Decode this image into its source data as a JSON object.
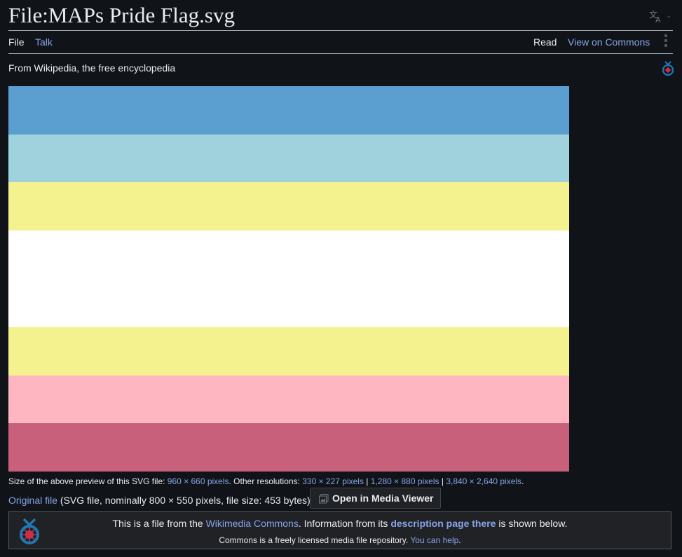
{
  "page": {
    "title": "File:MAPs Pride Flag.svg",
    "tagline": "From Wikipedia, the free encyclopedia",
    "language_icon": "translate-icon"
  },
  "tabs": {
    "file": "File",
    "talk": "Talk",
    "read": "Read",
    "view_on_commons": "View on Commons"
  },
  "flag": {
    "stripes": [
      {
        "color": "#5a9fd0"
      },
      {
        "color": "#a0d2de"
      },
      {
        "color": "#f4f28f"
      },
      {
        "color": "#ffffff"
      },
      {
        "color": "#f4f28f"
      },
      {
        "color": "#feb6c1"
      },
      {
        "color": "#c9607b"
      }
    ]
  },
  "size_info": {
    "prefix": "Size of the above preview of this SVG file: ",
    "preview_size": "960 × 660 pixels",
    "other_label": ". Other resolutions: ",
    "res1": "330 × 227 pixels",
    "separator": " | ",
    "res2": "1,280 × 880 pixels",
    "res3": "3,840 × 2,640 pixels",
    "suffix": "."
  },
  "original": {
    "link": "Original file",
    "details": " (SVG file, nominally 800 × 550 pixels, file size: 453 bytes)"
  },
  "media_viewer": {
    "label": "Open in Media Viewer"
  },
  "commons_notice": {
    "part1": "This is a file from the ",
    "link1": "Wikimedia Commons",
    "part2": ". Information from its ",
    "link2": "description page there",
    "part3": " is shown below.",
    "line2": "Commons is a freely licensed media file repository. ",
    "help_link": "You can help",
    "line2_end": "."
  },
  "colors": {
    "background": "#101418",
    "link": "#88a3e8",
    "text": "#eaecf0",
    "commons_logo_red": "#c9314a",
    "commons_logo_blue": "#1f78b4"
  }
}
